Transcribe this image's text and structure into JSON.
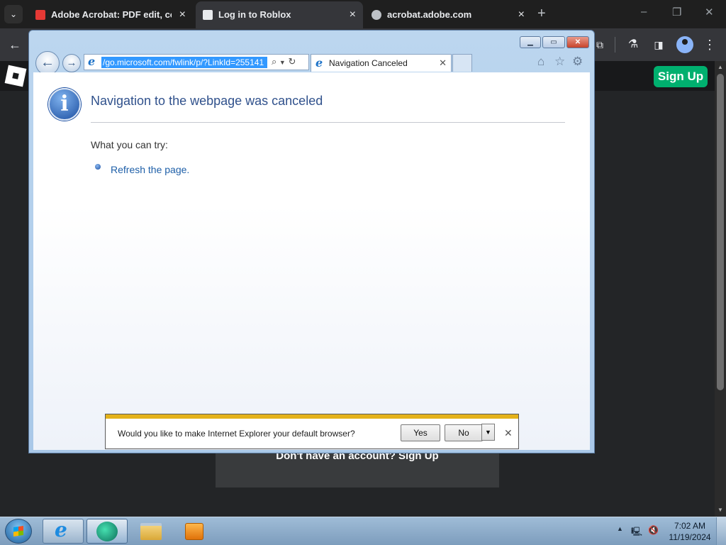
{
  "chrome": {
    "tabs": [
      {
        "title": "Adobe Acrobat: PDF edit, conv",
        "favicon": "acrobat-icon",
        "favicon_color": "#e53935"
      },
      {
        "title": "Log in to Roblox",
        "favicon": "roblox-icon",
        "favicon_color": "#e8eaed"
      },
      {
        "title": "acrobat.adobe.com",
        "favicon": "globe-icon",
        "favicon_color": "#bdc1c6"
      }
    ],
    "tab_close_glyph": "×",
    "new_tab_glyph": "+",
    "window_controls": {
      "minimize": "–",
      "restore": "❐",
      "close": "✕"
    },
    "toolbar_icons": [
      "back-icon",
      "extensions-icon",
      "labs-icon",
      "side-panel-icon",
      "profile-icon",
      "menu-icon"
    ]
  },
  "roblox": {
    "signup_label": "Sign Up",
    "login_prompt": "Don't have an account? Sign Up"
  },
  "ie": {
    "address_url": "/go.microsoft.com/fwlink/p/?LinkId=255141",
    "tab_title": "Navigation Canceled",
    "heading": "Navigation to the webpage was canceled",
    "try_label": "What you can try:",
    "refresh_link": "Refresh the page.",
    "notification": {
      "message": "Would you like to make Internet Explorer your default browser?",
      "yes_label": "Yes",
      "no_label": "No"
    }
  },
  "taskbar": {
    "clock_time": "7:02 AM",
    "clock_date": "11/19/2024",
    "pinned_apps": [
      "internet-explorer-icon",
      "media-center-icon",
      "file-explorer-icon",
      "media-player-icon"
    ]
  }
}
